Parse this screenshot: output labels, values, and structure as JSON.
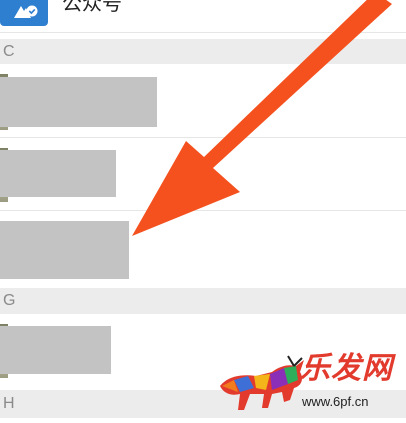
{
  "top_item": {
    "label": "公众号",
    "icon": "public-account-icon",
    "icon_color": "#2f7fd0"
  },
  "sections": [
    {
      "letter": "C"
    },
    {
      "letter": "G"
    },
    {
      "letter": "H"
    }
  ],
  "annotation": {
    "arrow_color": "#f4511e"
  },
  "watermark": {
    "title": "乐发网",
    "url": "www.6pf.cn",
    "logo": "bull-logo"
  },
  "colors": {
    "section_bg": "#ececec",
    "section_text": "#8a8a8a",
    "redaction": "#c3c3c3"
  }
}
